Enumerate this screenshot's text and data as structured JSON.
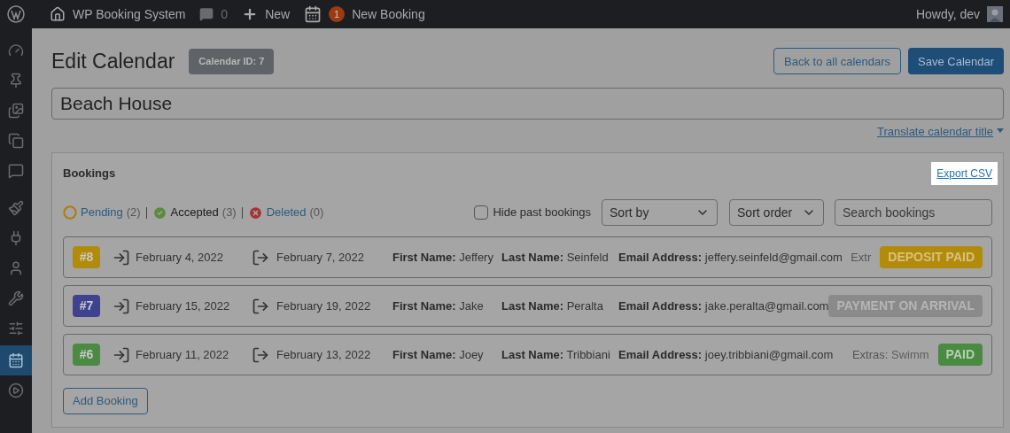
{
  "topbar": {
    "site": "WP Booking System",
    "comments": "0",
    "new": "New",
    "notifications": "1",
    "new_booking": "New Booking",
    "greeting": "Howdy, dev"
  },
  "sidebar": {
    "items": [
      {
        "selected": false
      },
      {
        "selected": false
      },
      {
        "selected": false
      },
      {
        "selected": false
      },
      {
        "selected": false
      },
      {
        "selected": false
      },
      {
        "selected": false
      },
      {
        "selected": false
      },
      {
        "selected": false
      },
      {
        "selected": false
      },
      {
        "selected": true
      },
      {
        "selected": false
      }
    ]
  },
  "page": {
    "title": "Edit Calendar",
    "calendar_id": "Calendar ID: 7",
    "back_button": "Back to all calendars",
    "save_button": "Save Calendar",
    "calendar_title": "Beach House",
    "translate_link": "Translate calendar title"
  },
  "bookings": {
    "heading": "Bookings",
    "export_link": "Export CSV",
    "filters": [
      {
        "kind": "pending",
        "label": "Pending",
        "count": "(2)",
        "selected": false
      },
      {
        "kind": "accepted",
        "label": "Accepted",
        "count": "(3)",
        "selected": true
      },
      {
        "kind": "deleted",
        "label": "Deleted",
        "count": "(0)",
        "selected": false
      }
    ],
    "hide_past": {
      "label": "Hide past bookings",
      "checked": false
    },
    "sort_by": "Sort by",
    "sort_order": "Sort order",
    "search_placeholder": "Search bookings",
    "rows": [
      {
        "id": "#8",
        "color": "#b38b0a",
        "start": "February 4, 2022",
        "end": "February 7, 2022",
        "first_name_label": "First Name:",
        "first_name": "Jeffery",
        "last_name_label": "Last Name:",
        "last_name": "Seinfeld",
        "email_label": "Email Address:",
        "email": "jeffery.seinfeld@gmail.com",
        "extras_label": "Extr",
        "status": "DEPOSIT PAID",
        "kind": "deposit"
      },
      {
        "id": "#7",
        "color": "#3f428f",
        "start": "February 15, 2022",
        "end": "February 19, 2022",
        "first_name_label": "First Name:",
        "first_name": "Jake",
        "last_name_label": "Last Name:",
        "last_name": "Peralta",
        "email_label": "Email Address:",
        "email": "jake.peralta@gmail.com",
        "status": "PAYMENT ON ARRIVAL",
        "kind": "arrival"
      },
      {
        "id": "#6",
        "color": "#4a8a43",
        "start": "February 11, 2022",
        "end": "February 13, 2022",
        "first_name_label": "First Name:",
        "first_name": "Joey",
        "last_name_label": "Last Name:",
        "last_name": "Tribbiani",
        "email_label": "Email Address:",
        "email": "joey.tribbiani@gmail.com",
        "extras_label": "Extras:",
        "extras_value": "Swimm",
        "status": "PAID",
        "kind": "paid"
      }
    ],
    "add_button": "Add Booking"
  }
}
